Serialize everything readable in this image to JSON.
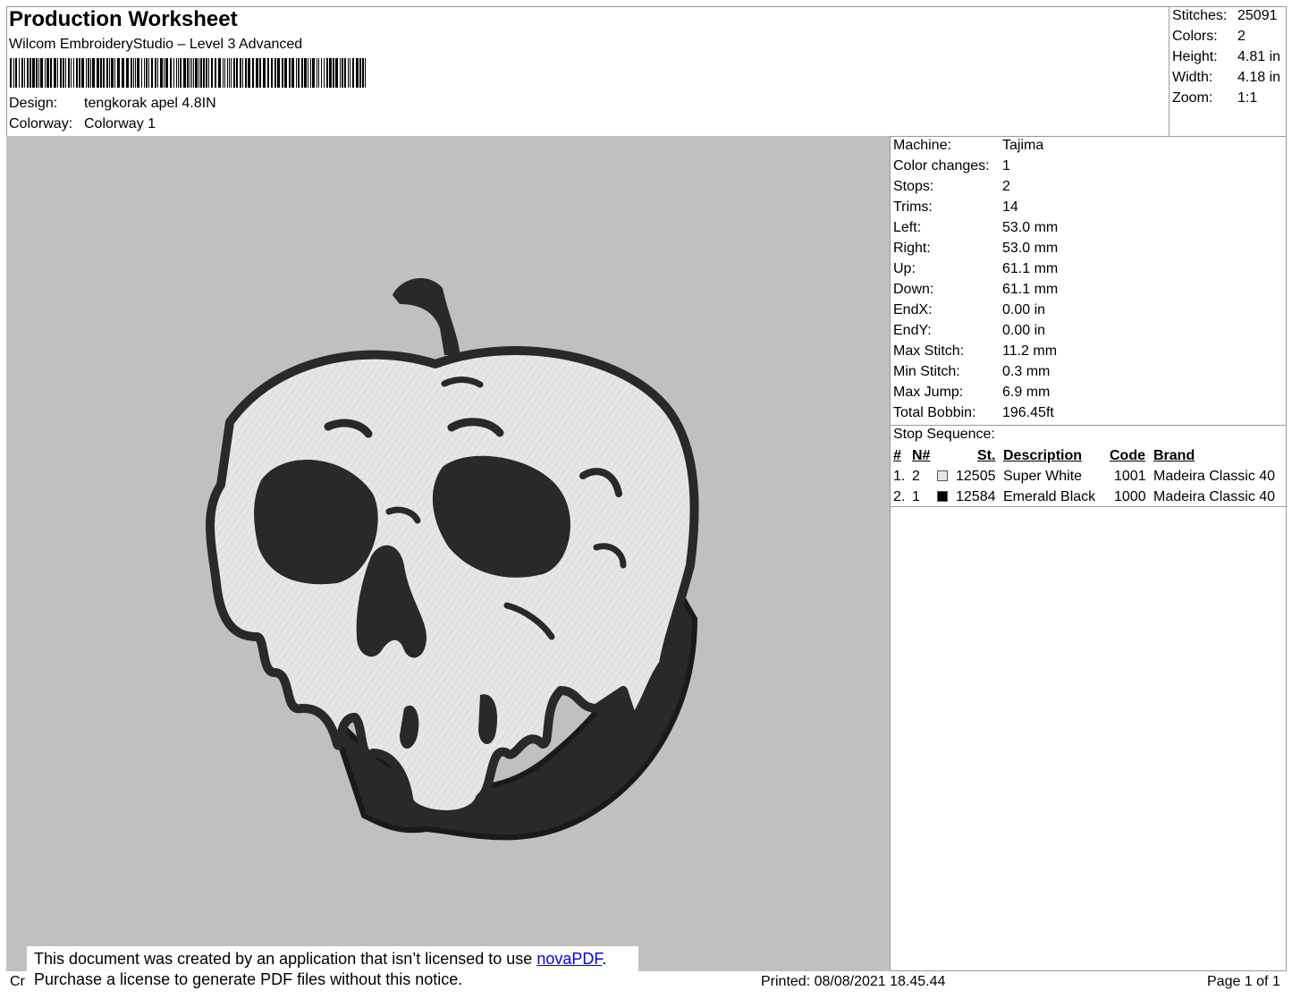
{
  "header": {
    "title": "Production Worksheet",
    "subtitle": "Wilcom EmbroideryStudio – Level 3 Advanced",
    "design_label": "Design:",
    "design_value": "tengkorak apel 4.8IN",
    "colorway_label": "Colorway:",
    "colorway_value": "Colorway 1"
  },
  "summary": [
    {
      "label": "Stitches:",
      "value": "25091"
    },
    {
      "label": "Colors:",
      "value": "2"
    },
    {
      "label": "Height:",
      "value": "4.81 in"
    },
    {
      "label": "Width:",
      "value": "4.18 in"
    },
    {
      "label": "Zoom:",
      "value": "1:1"
    }
  ],
  "details": [
    {
      "label": "Machine:",
      "value": "Tajima"
    },
    {
      "label": "Color changes:",
      "value": "1"
    },
    {
      "label": "Stops:",
      "value": "2"
    },
    {
      "label": "Trims:",
      "value": "14"
    },
    {
      "label": "Left:",
      "value": "53.0 mm"
    },
    {
      "label": "Right:",
      "value": "53.0 mm"
    },
    {
      "label": "Up:",
      "value": "61.1 mm"
    },
    {
      "label": "Down:",
      "value": "61.1 mm"
    },
    {
      "label": "EndX:",
      "value": "0.00 in"
    },
    {
      "label": "EndY:",
      "value": "0.00 in"
    },
    {
      "label": "Max Stitch:",
      "value": "11.2 mm"
    },
    {
      "label": "Min Stitch:",
      "value": "0.3 mm"
    },
    {
      "label": "Max Jump:",
      "value": "6.9 mm"
    },
    {
      "label": "Total Bobbin:",
      "value": "196.45ft"
    }
  ],
  "stop_sequence": {
    "label": "Stop Sequence:",
    "columns": {
      "num": "#",
      "n": "N#",
      "st": "St.",
      "description": "Description",
      "code": "Code",
      "brand": "Brand"
    },
    "rows": [
      {
        "num": "1.",
        "n": "2",
        "swatch": "#e6e6f0",
        "st": "12505",
        "description": "Super White",
        "code": "1001",
        "brand": "Madeira Classic 40"
      },
      {
        "num": "2.",
        "n": "1",
        "swatch": "#000000",
        "st": "12584",
        "description": "Emerald Black",
        "code": "1000",
        "brand": "Madeira Classic 40"
      }
    ]
  },
  "design_colors": {
    "fill": "#e4e6e8",
    "outline": "#272a27",
    "background": "#c0c0c0"
  },
  "footer": {
    "cut_text": "Cr",
    "notice_line1": "This document was created by an application that isn’t licensed to use ",
    "notice_link": "novaPDF",
    "notice_end": ".",
    "notice_line2": "Purchase a license to generate PDF files without this notice.",
    "printed": "Printed: 08/08/2021 18.45.44",
    "page": "Page 1 of 1"
  }
}
